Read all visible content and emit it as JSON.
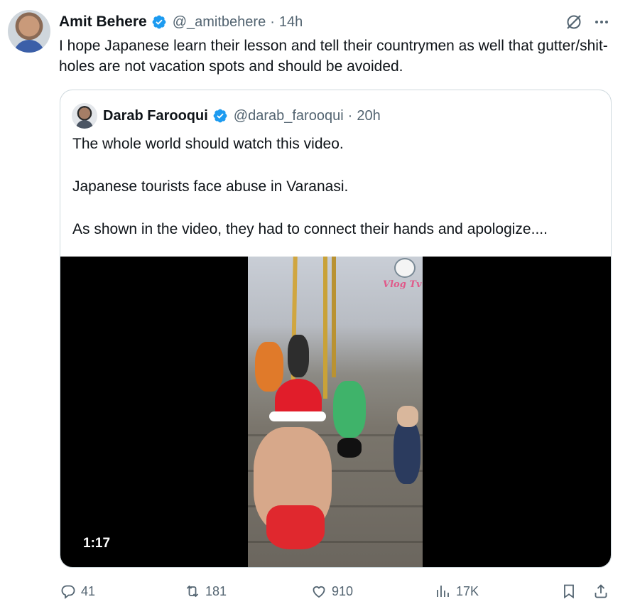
{
  "tweet": {
    "author": {
      "name": "Amit Behere",
      "handle": "@_amitbehere",
      "separator": "·",
      "time": "14h"
    },
    "text": "I hope Japanese learn their lesson and tell their countrymen as well that gutter/shit-holes are not vacation spots and should be avoided."
  },
  "quote": {
    "author": {
      "name": "Darab Farooqui",
      "handle": "@darab_farooqui",
      "separator": "·",
      "time": "20h"
    },
    "paragraphs": [
      "The whole world should watch this video.",
      "Japanese tourists face abuse in Varanasi.",
      "As shown in the video, they had to connect their hands and apologize...."
    ],
    "video": {
      "duration": "1:17",
      "watermark": "Vlog Tv"
    }
  },
  "actions": {
    "replies": "41",
    "reposts": "181",
    "likes": "910",
    "views": "17K"
  },
  "icons": {
    "verified": "verified-badge-icon",
    "grok": "grok-icon",
    "more": "more-icon",
    "reply": "reply-icon",
    "repost": "repost-icon",
    "like": "like-icon",
    "views": "views-icon",
    "bookmark": "bookmark-icon",
    "share": "share-icon"
  },
  "colors": {
    "verified": "#1d9bf0",
    "text": "#0f1419",
    "secondary": "#536471",
    "border": "#cfd9de"
  }
}
